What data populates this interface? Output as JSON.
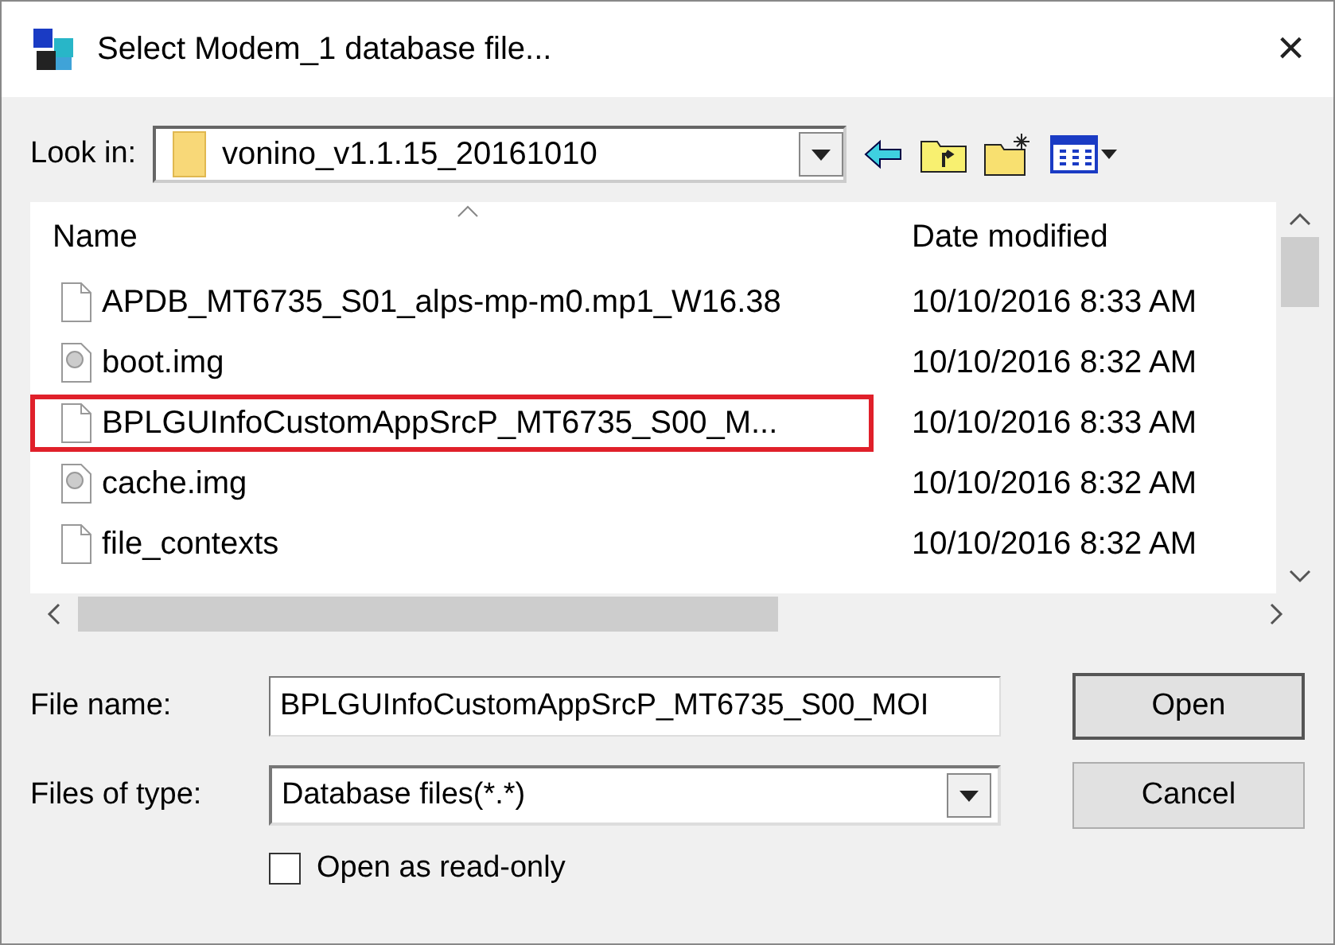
{
  "window": {
    "title": "Select Modem_1 database file...",
    "close": "×"
  },
  "look_in": {
    "label": "Look in:",
    "value": "vonino_v1.1.15_20161010"
  },
  "columns": [
    "Name",
    "Date modified"
  ],
  "files": [
    {
      "name": "APDB_MT6735_S01_alps-mp-m0.mp1_W16.38",
      "date": "10/10/2016 8:33 AM",
      "kind": "document",
      "outlined": false
    },
    {
      "name": "boot.img",
      "date": "10/10/2016 8:32 AM",
      "kind": "disc",
      "outlined": false
    },
    {
      "name": "BPLGUInfoCustomAppSrcP_MT6735_S00_M...",
      "date": "10/10/2016 8:33 AM",
      "kind": "document",
      "outlined": true
    },
    {
      "name": "cache.img",
      "date": "10/10/2016 8:32 AM",
      "kind": "disc",
      "outlined": false
    },
    {
      "name": "file_contexts",
      "date": "10/10/2016 8:32 AM",
      "kind": "document",
      "outlined": false
    }
  ],
  "file_name": {
    "label": "File name:",
    "value": "BPLGUInfoCustomAppSrcP_MT6735_S00_MOI"
  },
  "file_type": {
    "label": "Files of type:",
    "value": "Database files(*.*)"
  },
  "read_only": {
    "label": "Open as read-only",
    "checked": false
  },
  "buttons": [
    "Open",
    "Cancel"
  ]
}
